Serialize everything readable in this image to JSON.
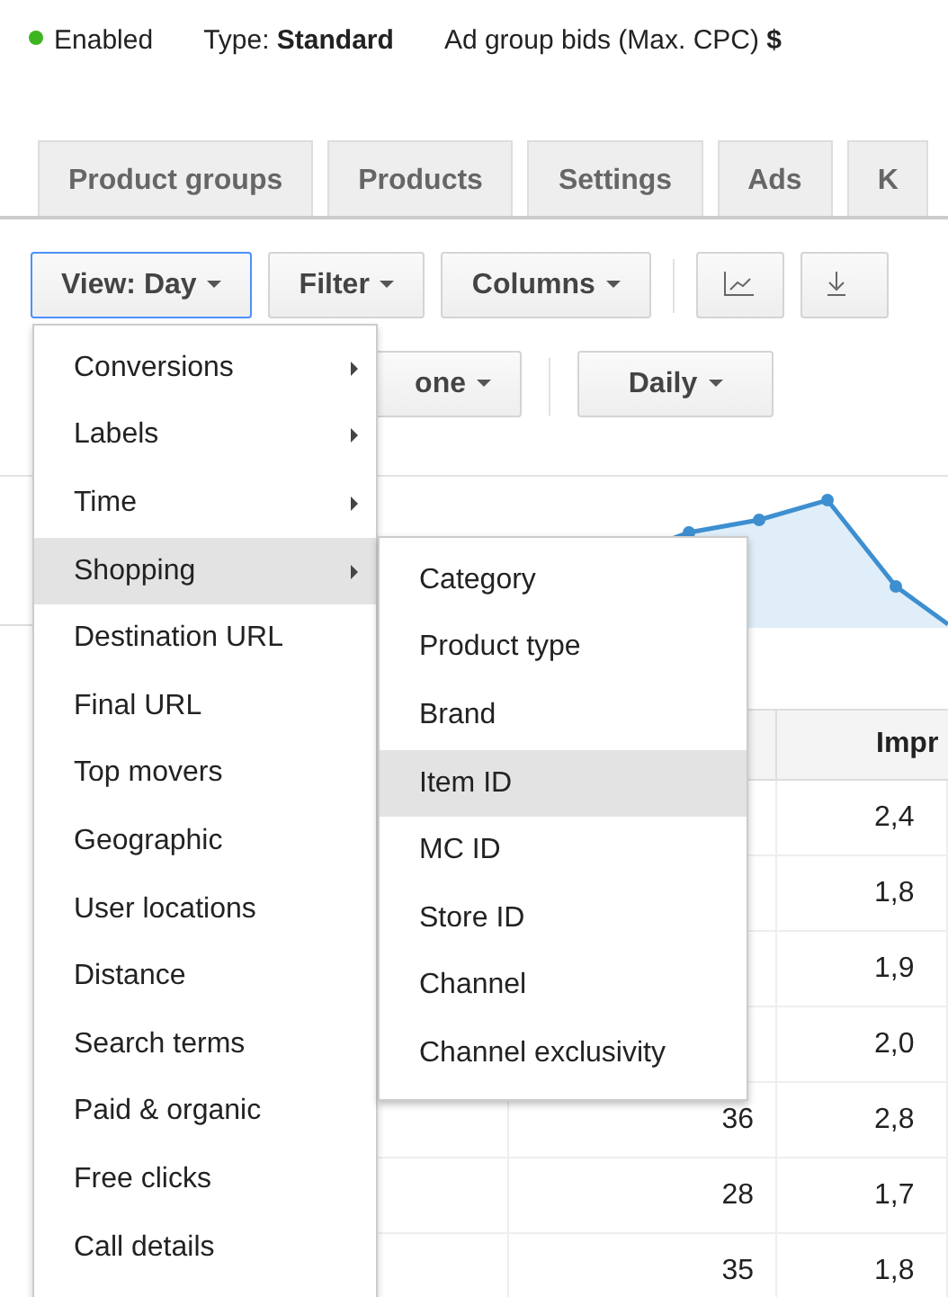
{
  "status": {
    "label": "Enabled",
    "color": "#3cb521"
  },
  "meta": [
    "Type: **Standard**",
    "Ad group bids (Max. CPC) **$**"
  ],
  "tabs": [
    {
      "label": "Product groups"
    },
    {
      "label": "Products"
    },
    {
      "label": "Settings"
    },
    {
      "label": "Ads"
    },
    {
      "label": "K"
    }
  ],
  "toolbar": [
    {
      "kind": "dropdown",
      "label": "View: Day",
      "open": true
    },
    {
      "kind": "dropdown",
      "label": "Filter",
      "open": false
    },
    {
      "kind": "dropdown",
      "label": "Columns",
      "open": false
    },
    {
      "kind": "chart"
    },
    {
      "kind": "download"
    }
  ],
  "toolbar_2": [
    {
      "label": "one"
    },
    {
      "label": "Daily"
    }
  ],
  "table": {
    "columns": [
      {
        "label": "Impr"
      }
    ],
    "rows": [
      {
        "cells": [
          "2,4"
        ]
      },
      {
        "cells": [
          "1,8"
        ]
      },
      {
        "cells": [
          "1,9"
        ]
      },
      {
        "cells": [
          "2,0"
        ]
      },
      {
        "clicks": "36",
        "cells": [
          "2,8"
        ]
      },
      {
        "clicks": "28",
        "cells": [
          "1,7"
        ]
      },
      {
        "clicks": "35",
        "cells": [
          "1,8"
        ]
      }
    ]
  },
  "view_menu": [
    {
      "label": "Conversions",
      "submenu": true,
      "highlighted": false
    },
    {
      "label": "Labels",
      "submenu": true,
      "highlighted": false
    },
    {
      "label": "Time",
      "submenu": true,
      "highlighted": false
    },
    {
      "label": "Shopping",
      "submenu": true,
      "highlighted": true
    },
    {
      "label": "Destination URL",
      "submenu": false,
      "highlighted": false
    },
    {
      "label": "Final URL",
      "submenu": false,
      "highlighted": false
    },
    {
      "label": "Top movers",
      "submenu": false,
      "highlighted": false
    },
    {
      "label": "Geographic",
      "submenu": false,
      "highlighted": false
    },
    {
      "label": "User locations",
      "submenu": false,
      "highlighted": false
    },
    {
      "label": "Distance",
      "submenu": false,
      "highlighted": false
    },
    {
      "label": "Search terms",
      "submenu": false,
      "highlighted": false
    },
    {
      "label": "Paid & organic",
      "submenu": false,
      "highlighted": false
    },
    {
      "label": "Free clicks",
      "submenu": false,
      "highlighted": false
    },
    {
      "label": "Call details",
      "submenu": false,
      "highlighted": false
    }
  ],
  "shopping_submenu": [
    {
      "label": "Category",
      "highlighted": false
    },
    {
      "label": "Product type",
      "highlighted": false
    },
    {
      "label": "Brand",
      "highlighted": false
    },
    {
      "label": "Item ID",
      "highlighted": true
    },
    {
      "label": "MC ID",
      "highlighted": false
    },
    {
      "label": "Store ID",
      "highlighted": false
    },
    {
      "label": "Channel",
      "highlighted": false
    },
    {
      "label": "Channel exclusivity",
      "highlighted": false
    }
  ]
}
